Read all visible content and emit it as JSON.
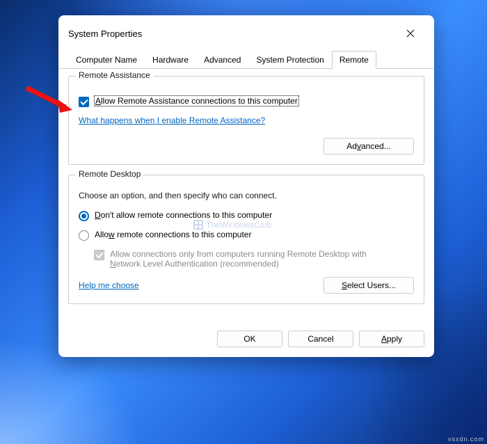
{
  "window": {
    "title": "System Properties"
  },
  "tabs": [
    {
      "label": "Computer Name"
    },
    {
      "label": "Hardware"
    },
    {
      "label": "Advanced"
    },
    {
      "label": "System Protection"
    },
    {
      "label": "Remote"
    }
  ],
  "remote_assistance": {
    "legend": "Remote Assistance",
    "allow_label": "Allow Remote Assistance connections to this computer",
    "help_link": "What happens when I enable Remote Assistance?",
    "advanced_btn": "Advanced..."
  },
  "remote_desktop": {
    "legend": "Remote Desktop",
    "desc": "Choose an option, and then specify who can connect.",
    "opt_dont": "Don't allow remote connections to this computer",
    "opt_allow": "Allow remote connections to this computer",
    "nla_label": "Allow connections only from computers running Remote Desktop with Network Level Authentication (recommended)",
    "help_link": "Help me choose",
    "select_users_btn": "Select Users..."
  },
  "buttons": {
    "ok": "OK",
    "cancel": "Cancel",
    "apply": "Apply"
  },
  "watermark": "TheWindowsClub",
  "footer": "vsxdn.com"
}
